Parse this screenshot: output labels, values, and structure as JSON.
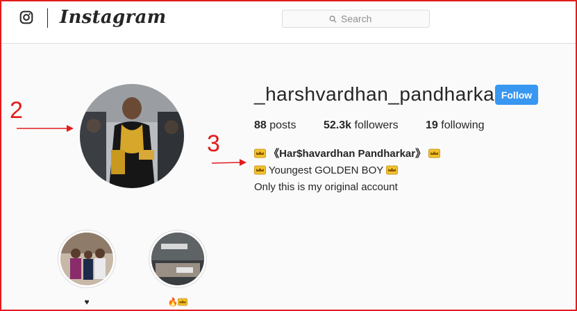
{
  "app": {
    "wordmark": "Instagram"
  },
  "search": {
    "placeholder": "Search"
  },
  "profile": {
    "username": "_harshvardhan_pandharkar_",
    "follow_label": "Follow",
    "stats": [
      {
        "count": "88",
        "label": "posts"
      },
      {
        "count": "52.3k",
        "label": "followers"
      },
      {
        "count": "19",
        "label": "following"
      }
    ],
    "bio": {
      "name": "《Har$havardhan Pandharkar》",
      "line2": " Youngest GOLDEN BOY ",
      "line3": "Only this is my original account"
    }
  },
  "annotations": {
    "avatar_number": "2",
    "bio_number": "3"
  },
  "highlights": [
    {
      "label": "♥"
    },
    {
      "label": "🔥"
    }
  ],
  "colors": {
    "follow_button": "#3897f0",
    "annotation": "#e31b1b",
    "crown": "#f2c12e"
  }
}
